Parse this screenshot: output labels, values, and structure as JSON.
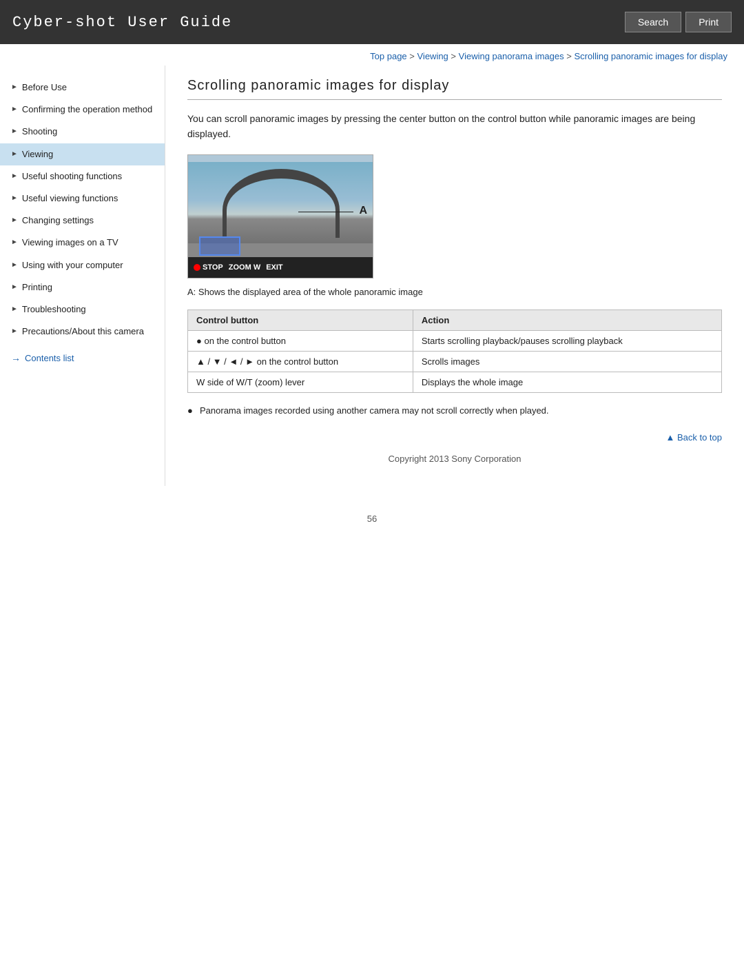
{
  "header": {
    "title": "Cyber-shot User Guide",
    "search_label": "Search",
    "print_label": "Print"
  },
  "breadcrumb": {
    "items": [
      {
        "label": "Top page",
        "href": "#"
      },
      {
        "label": "Viewing",
        "href": "#"
      },
      {
        "label": "Viewing panorama images",
        "href": "#"
      },
      {
        "label": "Scrolling panoramic images for display",
        "href": "#"
      }
    ]
  },
  "sidebar": {
    "items": [
      {
        "label": "Before Use",
        "active": false
      },
      {
        "label": "Confirming the operation method",
        "active": false
      },
      {
        "label": "Shooting",
        "active": false
      },
      {
        "label": "Viewing",
        "active": true
      },
      {
        "label": "Useful shooting functions",
        "active": false
      },
      {
        "label": "Useful viewing functions",
        "active": false
      },
      {
        "label": "Changing settings",
        "active": false
      },
      {
        "label": "Viewing images on a TV",
        "active": false
      },
      {
        "label": "Using with your computer",
        "active": false
      },
      {
        "label": "Printing",
        "active": false
      },
      {
        "label": "Troubleshooting",
        "active": false
      },
      {
        "label": "Precautions/About this camera",
        "active": false
      }
    ],
    "contents_list_label": "Contents list"
  },
  "main": {
    "page_title": "Scrolling panoramic images for display",
    "intro": "You can scroll panoramic images by pressing the center button on the control button while panoramic images are being displayed.",
    "caption_a": "A: Shows the displayed area of the whole panoramic image",
    "table": {
      "headers": [
        "Control button",
        "Action"
      ],
      "rows": [
        {
          "control": "● on the control button",
          "action": "Starts scrolling playback/pauses scrolling playback"
        },
        {
          "control": "▲ / ▼ / ◄ / ► on the control button",
          "action": "Scrolls images"
        },
        {
          "control": "W side of W/T (zoom) lever",
          "action": "Displays the whole image"
        }
      ]
    },
    "note": "Panorama images recorded using another camera may not scroll correctly when played.",
    "back_to_top": "▲ Back to top",
    "copyright": "Copyright 2013 Sony Corporation",
    "page_number": "56",
    "pano_toolbar": {
      "stop": "●STOP",
      "zoom": "ZOOM W",
      "exit": "EXIT"
    },
    "label_a": "A"
  }
}
